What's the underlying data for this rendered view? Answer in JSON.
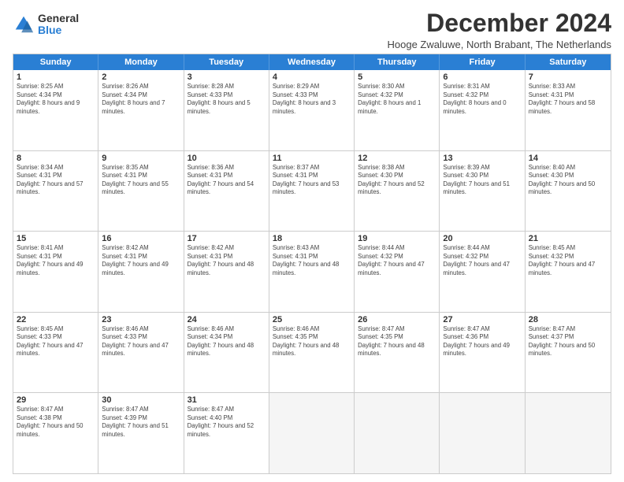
{
  "logo": {
    "general": "General",
    "blue": "Blue"
  },
  "title": "December 2024",
  "subtitle": "Hooge Zwaluwe, North Brabant, The Netherlands",
  "calendar": {
    "headers": [
      "Sunday",
      "Monday",
      "Tuesday",
      "Wednesday",
      "Thursday",
      "Friday",
      "Saturday"
    ],
    "weeks": [
      [
        {
          "day": "",
          "sunrise": "",
          "sunset": "",
          "daylight": "",
          "empty": true
        },
        {
          "day": "2",
          "sunrise": "Sunrise: 8:26 AM",
          "sunset": "Sunset: 4:34 PM",
          "daylight": "Daylight: 8 hours and 7 minutes."
        },
        {
          "day": "3",
          "sunrise": "Sunrise: 8:28 AM",
          "sunset": "Sunset: 4:33 PM",
          "daylight": "Daylight: 8 hours and 5 minutes."
        },
        {
          "day": "4",
          "sunrise": "Sunrise: 8:29 AM",
          "sunset": "Sunset: 4:33 PM",
          "daylight": "Daylight: 8 hours and 3 minutes."
        },
        {
          "day": "5",
          "sunrise": "Sunrise: 8:30 AM",
          "sunset": "Sunset: 4:32 PM",
          "daylight": "Daylight: 8 hours and 1 minute."
        },
        {
          "day": "6",
          "sunrise": "Sunrise: 8:31 AM",
          "sunset": "Sunset: 4:32 PM",
          "daylight": "Daylight: 8 hours and 0 minutes."
        },
        {
          "day": "7",
          "sunrise": "Sunrise: 8:33 AM",
          "sunset": "Sunset: 4:31 PM",
          "daylight": "Daylight: 7 hours and 58 minutes."
        }
      ],
      [
        {
          "day": "8",
          "sunrise": "Sunrise: 8:34 AM",
          "sunset": "Sunset: 4:31 PM",
          "daylight": "Daylight: 7 hours and 57 minutes."
        },
        {
          "day": "9",
          "sunrise": "Sunrise: 8:35 AM",
          "sunset": "Sunset: 4:31 PM",
          "daylight": "Daylight: 7 hours and 55 minutes."
        },
        {
          "day": "10",
          "sunrise": "Sunrise: 8:36 AM",
          "sunset": "Sunset: 4:31 PM",
          "daylight": "Daylight: 7 hours and 54 minutes."
        },
        {
          "day": "11",
          "sunrise": "Sunrise: 8:37 AM",
          "sunset": "Sunset: 4:31 PM",
          "daylight": "Daylight: 7 hours and 53 minutes."
        },
        {
          "day": "12",
          "sunrise": "Sunrise: 8:38 AM",
          "sunset": "Sunset: 4:30 PM",
          "daylight": "Daylight: 7 hours and 52 minutes."
        },
        {
          "day": "13",
          "sunrise": "Sunrise: 8:39 AM",
          "sunset": "Sunset: 4:30 PM",
          "daylight": "Daylight: 7 hours and 51 minutes."
        },
        {
          "day": "14",
          "sunrise": "Sunrise: 8:40 AM",
          "sunset": "Sunset: 4:30 PM",
          "daylight": "Daylight: 7 hours and 50 minutes."
        }
      ],
      [
        {
          "day": "15",
          "sunrise": "Sunrise: 8:41 AM",
          "sunset": "Sunset: 4:31 PM",
          "daylight": "Daylight: 7 hours and 49 minutes."
        },
        {
          "day": "16",
          "sunrise": "Sunrise: 8:42 AM",
          "sunset": "Sunset: 4:31 PM",
          "daylight": "Daylight: 7 hours and 49 minutes."
        },
        {
          "day": "17",
          "sunrise": "Sunrise: 8:42 AM",
          "sunset": "Sunset: 4:31 PM",
          "daylight": "Daylight: 7 hours and 48 minutes."
        },
        {
          "day": "18",
          "sunrise": "Sunrise: 8:43 AM",
          "sunset": "Sunset: 4:31 PM",
          "daylight": "Daylight: 7 hours and 48 minutes."
        },
        {
          "day": "19",
          "sunrise": "Sunrise: 8:44 AM",
          "sunset": "Sunset: 4:32 PM",
          "daylight": "Daylight: 7 hours and 47 minutes."
        },
        {
          "day": "20",
          "sunrise": "Sunrise: 8:44 AM",
          "sunset": "Sunset: 4:32 PM",
          "daylight": "Daylight: 7 hours and 47 minutes."
        },
        {
          "day": "21",
          "sunrise": "Sunrise: 8:45 AM",
          "sunset": "Sunset: 4:32 PM",
          "daylight": "Daylight: 7 hours and 47 minutes."
        }
      ],
      [
        {
          "day": "22",
          "sunrise": "Sunrise: 8:45 AM",
          "sunset": "Sunset: 4:33 PM",
          "daylight": "Daylight: 7 hours and 47 minutes."
        },
        {
          "day": "23",
          "sunrise": "Sunrise: 8:46 AM",
          "sunset": "Sunset: 4:33 PM",
          "daylight": "Daylight: 7 hours and 47 minutes."
        },
        {
          "day": "24",
          "sunrise": "Sunrise: 8:46 AM",
          "sunset": "Sunset: 4:34 PM",
          "daylight": "Daylight: 7 hours and 48 minutes."
        },
        {
          "day": "25",
          "sunrise": "Sunrise: 8:46 AM",
          "sunset": "Sunset: 4:35 PM",
          "daylight": "Daylight: 7 hours and 48 minutes."
        },
        {
          "day": "26",
          "sunrise": "Sunrise: 8:47 AM",
          "sunset": "Sunset: 4:35 PM",
          "daylight": "Daylight: 7 hours and 48 minutes."
        },
        {
          "day": "27",
          "sunrise": "Sunrise: 8:47 AM",
          "sunset": "Sunset: 4:36 PM",
          "daylight": "Daylight: 7 hours and 49 minutes."
        },
        {
          "day": "28",
          "sunrise": "Sunrise: 8:47 AM",
          "sunset": "Sunset: 4:37 PM",
          "daylight": "Daylight: 7 hours and 50 minutes."
        }
      ],
      [
        {
          "day": "29",
          "sunrise": "Sunrise: 8:47 AM",
          "sunset": "Sunset: 4:38 PM",
          "daylight": "Daylight: 7 hours and 50 minutes."
        },
        {
          "day": "30",
          "sunrise": "Sunrise: 8:47 AM",
          "sunset": "Sunset: 4:39 PM",
          "daylight": "Daylight: 7 hours and 51 minutes."
        },
        {
          "day": "31",
          "sunrise": "Sunrise: 8:47 AM",
          "sunset": "Sunset: 4:40 PM",
          "daylight": "Daylight: 7 hours and 52 minutes."
        },
        {
          "day": "",
          "sunrise": "",
          "sunset": "",
          "daylight": "",
          "empty": true
        },
        {
          "day": "",
          "sunrise": "",
          "sunset": "",
          "daylight": "",
          "empty": true
        },
        {
          "day": "",
          "sunrise": "",
          "sunset": "",
          "daylight": "",
          "empty": true
        },
        {
          "day": "",
          "sunrise": "",
          "sunset": "",
          "daylight": "",
          "empty": true
        }
      ]
    ]
  },
  "week1_day1": {
    "day": "1",
    "sunrise": "Sunrise: 8:25 AM",
    "sunset": "Sunset: 4:34 PM",
    "daylight": "Daylight: 8 hours and 9 minutes."
  }
}
